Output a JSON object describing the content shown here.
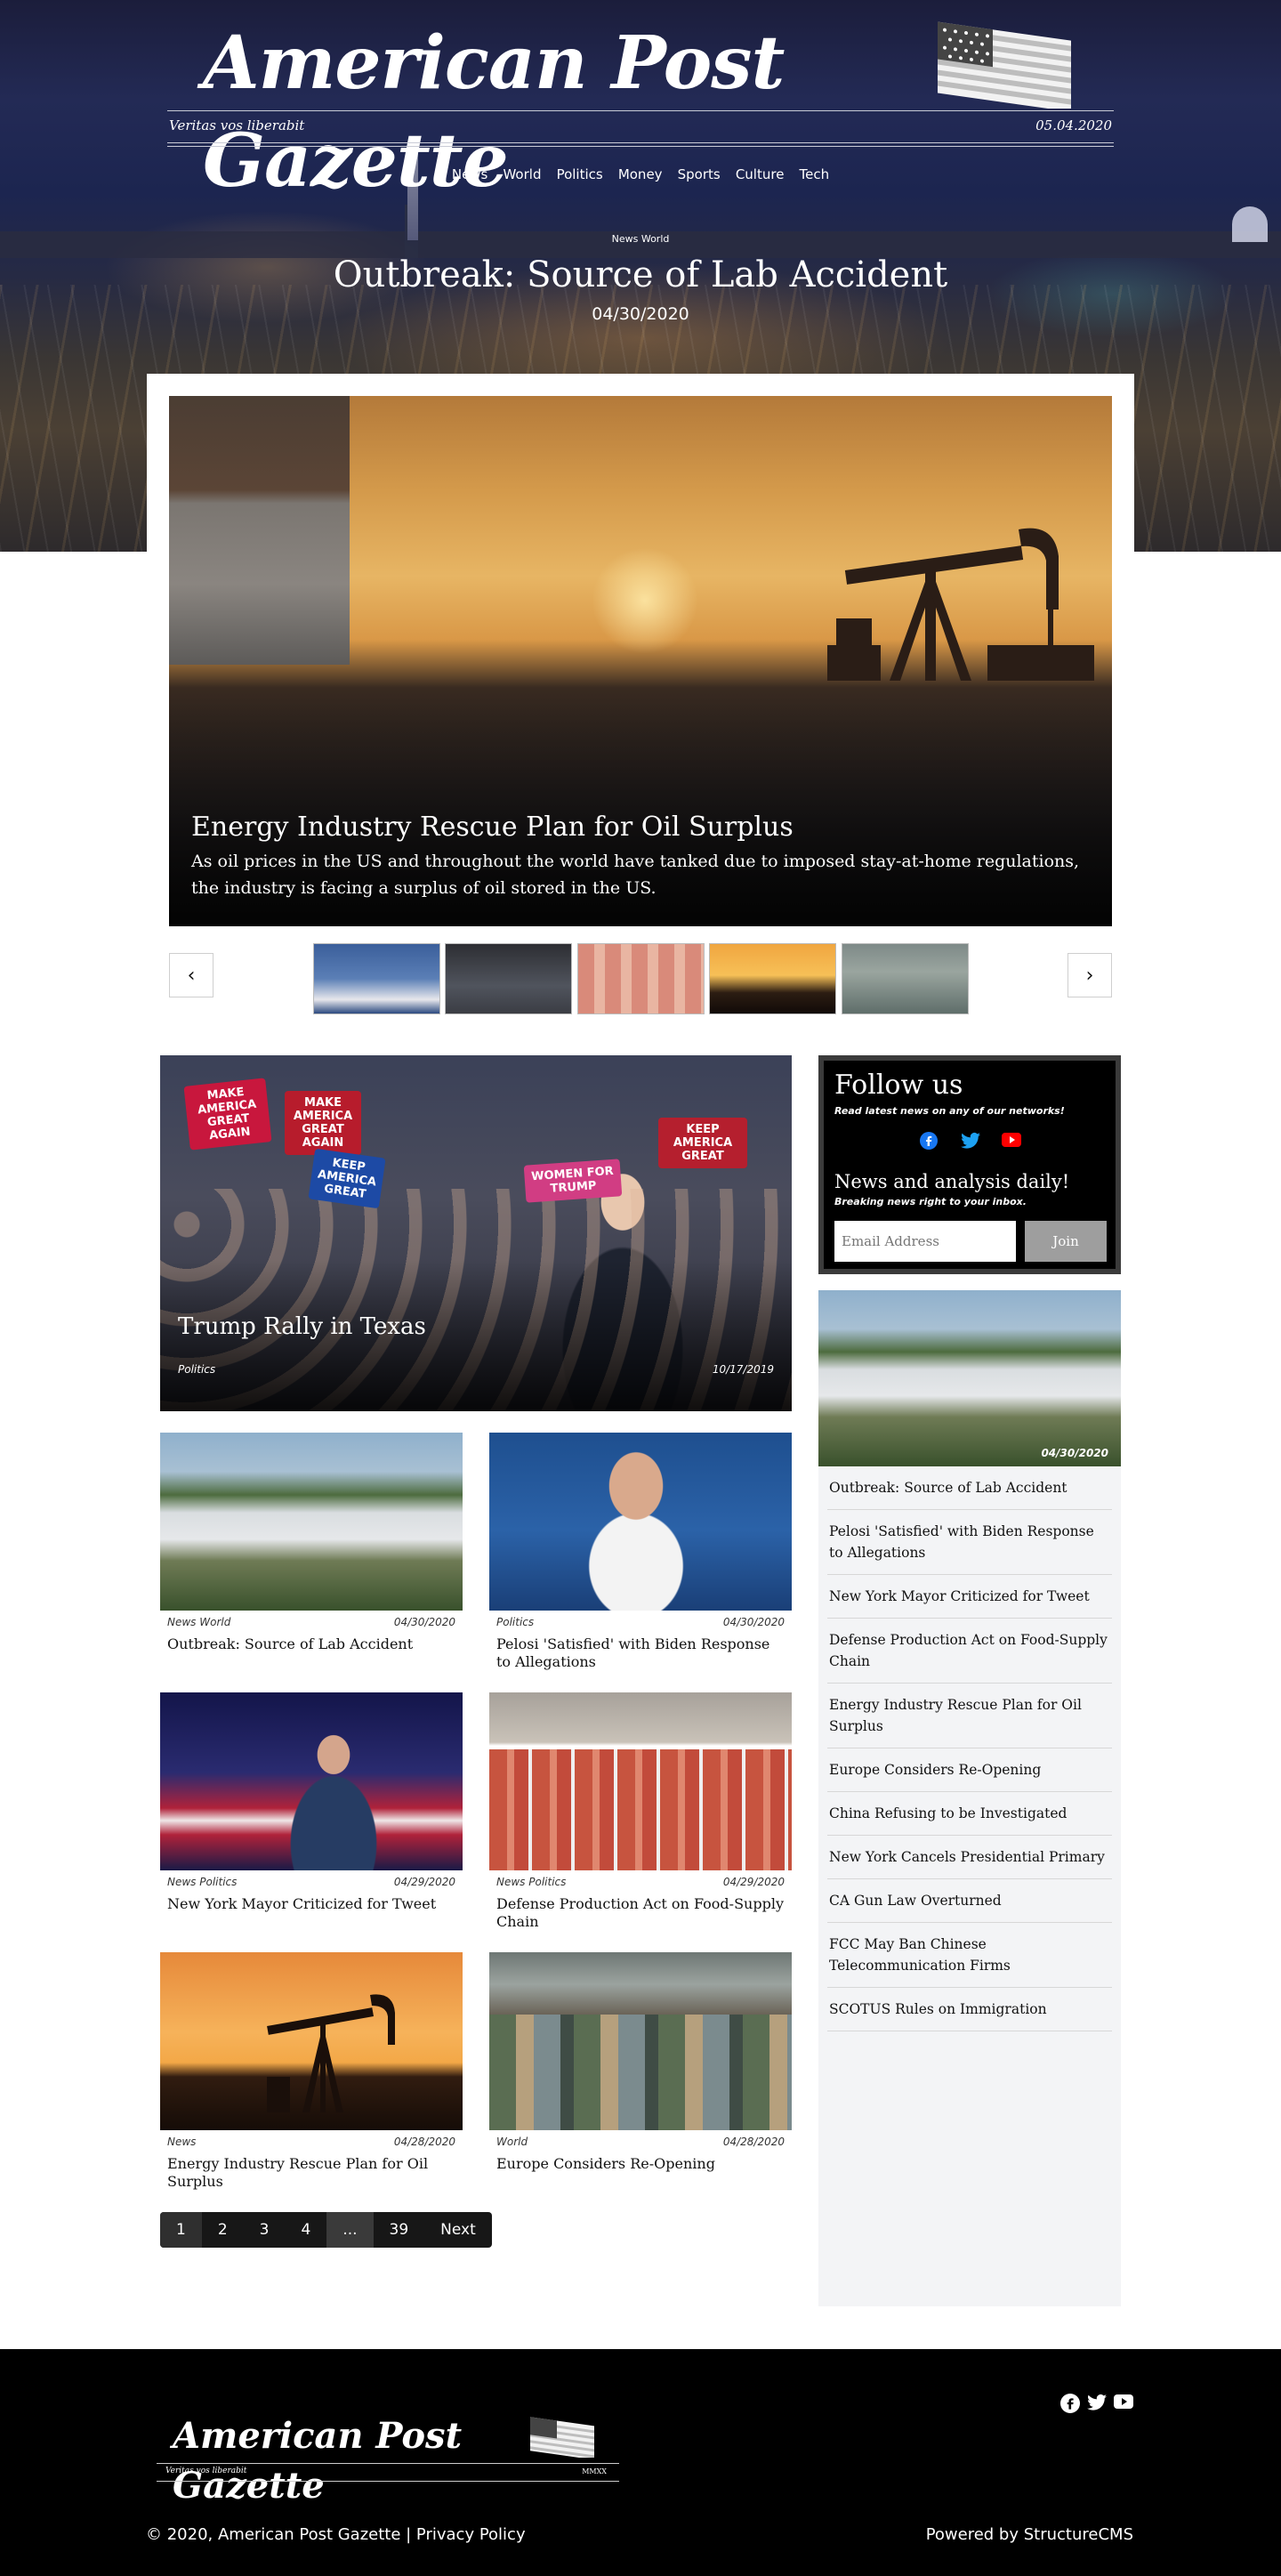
{
  "masthead": {
    "title": "American Post Gazette",
    "motto": "Veritas vos liberabit",
    "date": "05.04.2020"
  },
  "nav": [
    "News",
    "World",
    "Politics",
    "Money",
    "Sports",
    "Culture",
    "Tech"
  ],
  "hero": {
    "category": "News World",
    "title": "Outbreak: Source of Lab Accident",
    "date": "04/30/2020"
  },
  "carousel": {
    "title": "Energy Industry Rescue Plan for Oil Surplus",
    "description": "As oil prices in the US and throughout the world have tanked due to imposed stay-at-home regulations, the industry is facing a surplus of oil stored in the US.",
    "prev_icon": "chevron-left-icon",
    "next_icon": "chevron-right-icon",
    "prev_glyph": "‹",
    "next_glyph": "›"
  },
  "feature": {
    "title": "Trump Rally in Texas",
    "category": "Politics",
    "date": "10/17/2019",
    "signs": [
      "MAKE AMERICA GREAT AGAIN",
      "WOMEN FOR TRUMP",
      "KEEP AMERICA GREAT"
    ]
  },
  "articles": [
    {
      "category": "News World",
      "date": "04/30/2020",
      "title": "Outbreak: Source of Lab Accident"
    },
    {
      "category": "Politics",
      "date": "04/30/2020",
      "title": "Pelosi 'Satisfied' with Biden Response to Allegations"
    },
    {
      "category": "News Politics",
      "date": "04/29/2020",
      "title": "New York Mayor Criticized for Tweet"
    },
    {
      "category": "News Politics",
      "date": "04/29/2020",
      "title": "Defense Production Act on Food-Supply Chain"
    },
    {
      "category": "News",
      "date": "04/28/2020",
      "title": "Energy Industry Rescue Plan for Oil Surplus"
    },
    {
      "category": "World",
      "date": "04/28/2020",
      "title": "Europe Considers Re-Opening"
    }
  ],
  "pagination": [
    "1",
    "2",
    "3",
    "4",
    "...",
    "39",
    "Next"
  ],
  "follow": {
    "title": "Follow us",
    "subtitle": "Read latest news on any of our networks!",
    "newsletter_title": "News and analysis daily!",
    "newsletter_subtitle": "Breaking news right to your inbox.",
    "email_placeholder": "Email Address",
    "join_label": "Join",
    "social_icons": [
      "facebook-icon",
      "twitter-icon",
      "youtube-icon"
    ],
    "colors": {
      "facebook": "#1877f2",
      "twitter": "#1da1f2",
      "youtube": "#ff0000"
    }
  },
  "sidebar": {
    "image_date": "04/30/2020",
    "items": [
      "Outbreak: Source of Lab Accident",
      "Pelosi 'Satisfied' with Biden Response to Allegations",
      "New York Mayor Criticized for Tweet",
      "Defense Production Act on Food-Supply Chain",
      "Energy Industry Rescue Plan for Oil Surplus",
      "Europe Considers Re-Opening",
      "China Refusing to be Investigated",
      "New York Cancels Presidential Primary",
      "CA Gun Law Overturned",
      "FCC May Ban Chinese Telecommunication Firms",
      "SCOTUS Rules on Immigration"
    ]
  },
  "footer": {
    "logo_title": "American Post Gazette",
    "logo_motto": "Veritas vos liberabit",
    "logo_year": "MMXX",
    "copyright": "© 2020, American Post Gazette | Privacy Policy",
    "powered_by": "Powered by StructureCMS",
    "social_icons": [
      "facebook-icon",
      "twitter-icon",
      "youtube-icon"
    ]
  }
}
